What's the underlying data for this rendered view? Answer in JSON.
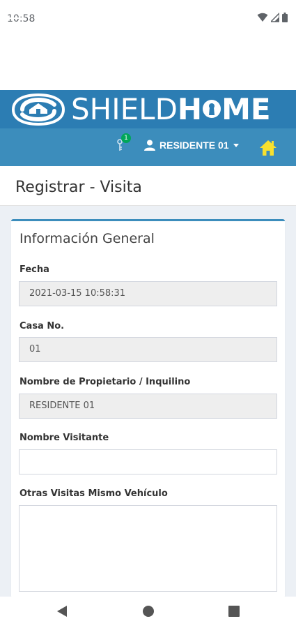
{
  "status_bar": {
    "time": "10:58"
  },
  "brand": {
    "logo_text_light": "SHIELD",
    "logo_text_bold": "H",
    "logo_text_bold_end": "ME"
  },
  "nav": {
    "notification_count": "1",
    "user_label": "RESIDENTE 01"
  },
  "page": {
    "title": "Registrar - Visita"
  },
  "card": {
    "title": "Información General",
    "fields": {
      "fecha_label": "Fecha",
      "fecha_value": "2021-03-15 10:58:31",
      "casa_label": "Casa No.",
      "casa_value": "01",
      "propietario_label": "Nombre de Propietario / Inquilino",
      "propietario_value": "RESIDENTE 01",
      "visitante_label": "Nombre Visitante",
      "visitante_value": "",
      "otras_label": "Otras Visitas Mismo Vehículo",
      "otras_value": ""
    }
  },
  "colors": {
    "brand_bar": "#2c7db3",
    "nav_bar": "#3c8dbc",
    "home_icon": "#f7e12f",
    "badge": "#00a65a"
  },
  "icons": {
    "wifi": "wifi-icon",
    "signal": "signal-icon",
    "battery": "battery-icon",
    "menu": "hamburger-icon",
    "notification": "key-icon",
    "user": "user-icon",
    "home": "home-icon"
  }
}
